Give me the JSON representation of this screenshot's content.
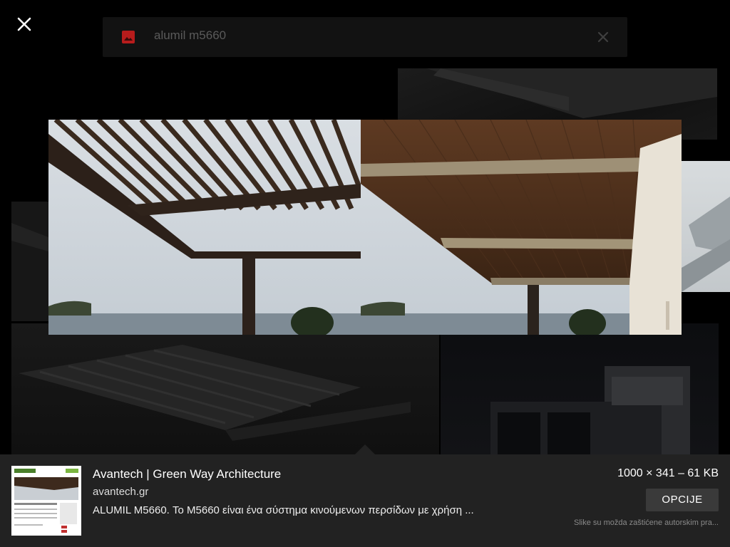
{
  "search": {
    "query": "alumil m5660"
  },
  "icons": {
    "close": "close-icon",
    "image": "image-icon",
    "clear": "clear-icon"
  },
  "colors": {
    "background": "#000000",
    "panel": "#222222",
    "image_icon": "#c62828",
    "button": "#3a3a3a"
  },
  "result": {
    "title": "Avantech | Green Way Architecture",
    "domain": "avantech.gr",
    "description": "ALUMIL M5660. Το M5660 είναι ένα σύστημα κινούμενων περσίδων με χρήση ...",
    "dimensions": "1000 × 341 – 61 KB",
    "options_label": "OPCIJE",
    "copyright_notice": "Slike su možda zaštićene autorskim pra..."
  }
}
